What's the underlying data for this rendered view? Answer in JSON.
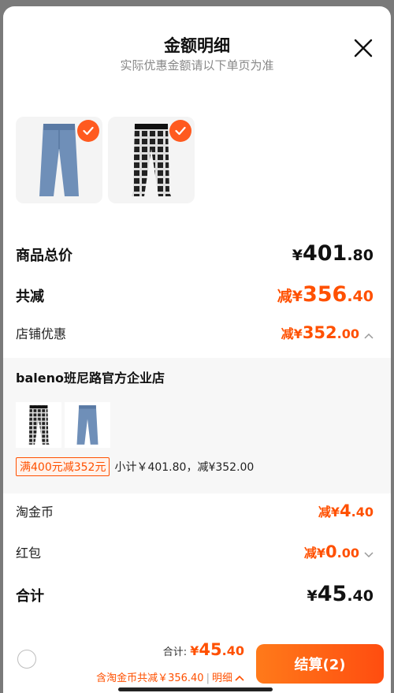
{
  "header": {
    "title": "金额明细",
    "subtitle": "实际优惠金额请以下单页为准"
  },
  "products": [
    {
      "name": "jeans-thumb",
      "checked": true
    },
    {
      "name": "plaid-pants-thumb",
      "checked": true
    }
  ],
  "summary": {
    "goods_total_label": "商品总价",
    "goods_total_currency": "¥",
    "goods_total_int": "401",
    "goods_total_dec": ".80",
    "reduce_label": "共减",
    "reduce_prefix": "减¥",
    "reduce_int": "356",
    "reduce_dec": ".40",
    "store_discount_label": "店铺优惠",
    "store_discount_prefix": "减¥",
    "store_discount_int": "352",
    "store_discount_dec": ".00"
  },
  "store": {
    "name": "baleno班尼路官方企业店",
    "promo_tag": "满400元减352元",
    "subtotal": "小计￥401.80，减¥352.00"
  },
  "extras": {
    "coin_label": "淘金币",
    "coin_prefix": "减¥",
    "coin_int": "4",
    "coin_dec": ".40",
    "redpack_label": "红包",
    "redpack_prefix": "减¥",
    "redpack_int": "0",
    "redpack_dec": ".00",
    "sum_label": "合计",
    "sum_currency": "¥",
    "sum_int": "45",
    "sum_dec": ".40"
  },
  "footer": {
    "total_label": "合计: ",
    "total_currency": "¥",
    "total_int": "45",
    "total_dec": ".40",
    "note": "含淘金币共减￥356.40",
    "detail_link": "明细",
    "pay_button": "结算(2)"
  },
  "colors": {
    "accent": "#ff5000",
    "sheet_bg": "#ffffff",
    "overlay": "#7a7a7a"
  }
}
